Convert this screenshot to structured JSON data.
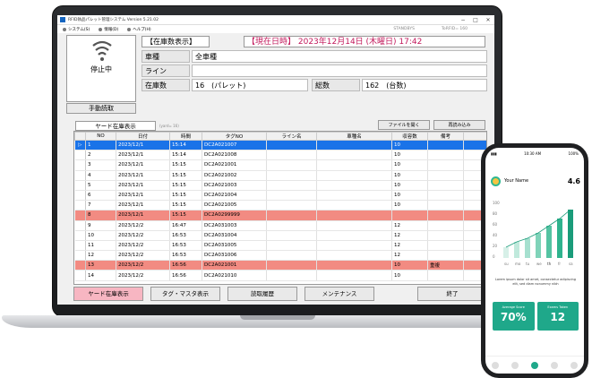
{
  "window": {
    "title": "RFID執品パレット管理システム Version 5.21.02"
  },
  "menu": [
    {
      "label": "システム(S)"
    },
    {
      "label": "情報(D)"
    },
    {
      "label": "ヘルプ(H)"
    }
  ],
  "menu_status": "STANDBYS",
  "menu_status2": "ToRFID= 160",
  "reader": {
    "state": "停止中",
    "manual_button": "手動読取"
  },
  "panel": {
    "title": "【在庫数表示】",
    "datetime": "【現在日時】 2023年12月14日 (木曜日) 17:42",
    "vehicle_label": "車種",
    "vehicle_value": "全車種",
    "line_label": "ライン",
    "line_value": "",
    "stock_label": "在庫数",
    "stock_value": "16　(パレット)",
    "total_label": "総数",
    "total_value": "162　(台数)"
  },
  "yard_tab": "ヤード在庫表示",
  "yard_hint": "(yard= 16)",
  "buttons": {
    "open_file": "ファイルを開く",
    "reload": "再読み込み"
  },
  "table": {
    "columns": [
      "NO",
      "日付",
      "時間",
      "タグNO",
      "ライン名",
      "車種名",
      "収容数",
      "備考"
    ],
    "rows": [
      {
        "no": "1",
        "date": "2023/12/1",
        "time": "15:14",
        "tag": "DC2A021007",
        "line": "",
        "vehicle": "",
        "qty": "10",
        "note": "",
        "state": "selected"
      },
      {
        "no": "2",
        "date": "2023/12/1",
        "time": "15:14",
        "tag": "DC2A021008",
        "line": "",
        "vehicle": "",
        "qty": "10",
        "note": "",
        "state": ""
      },
      {
        "no": "3",
        "date": "2023/12/1",
        "time": "15:15",
        "tag": "DC2A021001",
        "line": "",
        "vehicle": "",
        "qty": "10",
        "note": "",
        "state": ""
      },
      {
        "no": "4",
        "date": "2023/12/1",
        "time": "15:15",
        "tag": "DC2A021002",
        "line": "",
        "vehicle": "",
        "qty": "10",
        "note": "",
        "state": ""
      },
      {
        "no": "5",
        "date": "2023/12/1",
        "time": "15:15",
        "tag": "DC2A021003",
        "line": "",
        "vehicle": "",
        "qty": "10",
        "note": "",
        "state": ""
      },
      {
        "no": "6",
        "date": "2023/12/1",
        "time": "15:15",
        "tag": "DC2A021004",
        "line": "",
        "vehicle": "",
        "qty": "10",
        "note": "",
        "state": ""
      },
      {
        "no": "7",
        "date": "2023/12/1",
        "time": "15:15",
        "tag": "DC2A021005",
        "line": "",
        "vehicle": "",
        "qty": "10",
        "note": "",
        "state": ""
      },
      {
        "no": "8",
        "date": "2023/12/1",
        "time": "15:15",
        "tag": "DC2A0299999",
        "line": "",
        "vehicle": "",
        "qty": "",
        "note": "",
        "state": "alert"
      },
      {
        "no": "9",
        "date": "2023/12/2",
        "time": "16:47",
        "tag": "DC2A031003",
        "line": "",
        "vehicle": "",
        "qty": "12",
        "note": "",
        "state": ""
      },
      {
        "no": "10",
        "date": "2023/12/2",
        "time": "16:53",
        "tag": "DC2A031004",
        "line": "",
        "vehicle": "",
        "qty": "12",
        "note": "",
        "state": ""
      },
      {
        "no": "11",
        "date": "2023/12/2",
        "time": "16:53",
        "tag": "DC2A031005",
        "line": "",
        "vehicle": "",
        "qty": "12",
        "note": "",
        "state": ""
      },
      {
        "no": "12",
        "date": "2023/12/2",
        "time": "16:53",
        "tag": "DC2A031006",
        "line": "",
        "vehicle": "",
        "qty": "12",
        "note": "",
        "state": ""
      },
      {
        "no": "13",
        "date": "2023/12/2",
        "time": "16:56",
        "tag": "DC2A021001",
        "line": "",
        "vehicle": "",
        "qty": "10",
        "note": "重複",
        "state": "alert"
      },
      {
        "no": "14",
        "date": "2023/12/2",
        "time": "16:56",
        "tag": "DC2A021010",
        "line": "",
        "vehicle": "",
        "qty": "10",
        "note": "",
        "state": ""
      }
    ]
  },
  "bottom_buttons": [
    {
      "label": "ヤード在庫表示",
      "active": true
    },
    {
      "label": "タグ・マスタ表示",
      "active": false
    },
    {
      "label": "読取履歴",
      "active": false
    },
    {
      "label": "メンテナンス",
      "active": false
    },
    {
      "label": "終了",
      "active": false
    }
  ],
  "phone": {
    "time": "10:30 AM",
    "battery": "100%",
    "user": "Your Name",
    "score": "4.6",
    "chart_days": [
      "su",
      "mo",
      "tu",
      "we",
      "th",
      "fr",
      "sa"
    ],
    "y_ticks": [
      "100",
      "80",
      "60",
      "40",
      "20",
      "0"
    ],
    "text": "Lorem ipsum dolor sit amet, consectetur adipiscing elit, sed diam nonummy nibh",
    "card1_title": "Average Score",
    "card1_value": "70%",
    "card2_title": "Exams Taken",
    "card2_value": "12"
  }
}
